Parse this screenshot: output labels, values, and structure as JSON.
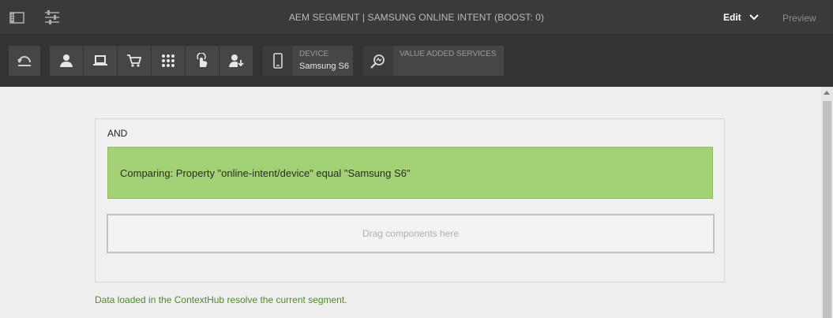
{
  "header": {
    "title": "AEM SEGMENT | SAMSUNG ONLINE INTENT (BOOST: 0)",
    "mode_label": "Edit",
    "preview_label": "Preview",
    "left_icons": [
      "side-panel-icon",
      "properties-icon"
    ]
  },
  "toolbar": {
    "tool_icons": [
      "undo-icon",
      "user-icon",
      "laptop-icon",
      "cart-icon",
      "grid-icon",
      "touch-icon",
      "user-arrow-icon"
    ],
    "device": {
      "label": "DEVICE",
      "value": "Samsung S6",
      "icon": "mobile-icon"
    },
    "services": {
      "label": "VALUE ADDED SERVICES",
      "value": "",
      "icon": "search-services-icon"
    }
  },
  "editor": {
    "group_operator": "AND",
    "condition_text": "Comparing: Property \"online-intent/device\" equal \"Samsung S6\"",
    "drop_placeholder": "Drag components here"
  },
  "status_message": "Data loaded in the ContextHub resolve the current segment.",
  "colors": {
    "condition_bg": "#a3d175",
    "status_text": "#4f8a2b",
    "topbar_bg": "#3a3a3a",
    "toolbar_bg": "#333333"
  }
}
